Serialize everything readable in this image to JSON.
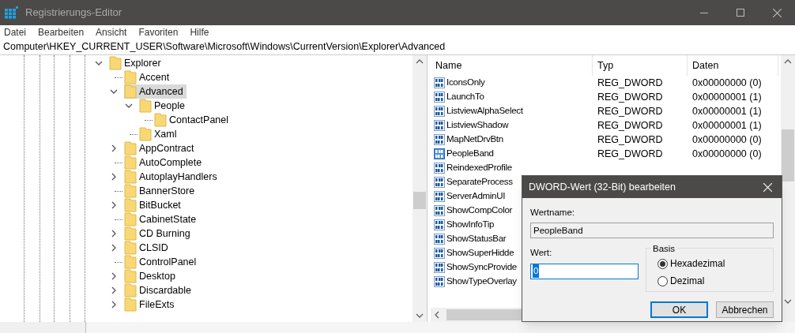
{
  "window": {
    "title": "Registrierungs-Editor"
  },
  "menu": [
    {
      "label": "Datei"
    },
    {
      "label": "Bearbeiten"
    },
    {
      "label": "Ansicht"
    },
    {
      "label": "Favoriten"
    },
    {
      "label": "Hilfe"
    }
  ],
  "address": "Computer\\HKEY_CURRENT_USER\\Software\\Microsoft\\Windows\\CurrentVersion\\Explorer\\Advanced",
  "tree": [
    {
      "label": "Explorer",
      "kind": "expanded",
      "selected": false,
      "children": [
        {
          "label": "Accent",
          "kind": "leaf",
          "selected": false
        },
        {
          "label": "Advanced",
          "kind": "expanded",
          "selected": true,
          "children": [
            {
              "label": "People",
              "kind": "expanded",
              "selected": false,
              "children": [
                {
                  "label": "ContactPanel",
                  "kind": "leaf",
                  "selected": false
                }
              ]
            },
            {
              "label": "Xaml",
              "kind": "leaf",
              "selected": false
            }
          ]
        },
        {
          "label": "AppContract",
          "kind": "collapsed",
          "selected": false
        },
        {
          "label": "AutoComplete",
          "kind": "leaf",
          "selected": false
        },
        {
          "label": "AutoplayHandlers",
          "kind": "collapsed",
          "selected": false
        },
        {
          "label": "BannerStore",
          "kind": "leaf",
          "selected": false
        },
        {
          "label": "BitBucket",
          "kind": "collapsed",
          "selected": false
        },
        {
          "label": "CabinetState",
          "kind": "leaf",
          "selected": false
        },
        {
          "label": "CD Burning",
          "kind": "collapsed",
          "selected": false
        },
        {
          "label": "CLSID",
          "kind": "collapsed",
          "selected": false
        },
        {
          "label": "ControlPanel",
          "kind": "leaf",
          "selected": false
        },
        {
          "label": "Desktop",
          "kind": "collapsed",
          "selected": false
        },
        {
          "label": "Discardable",
          "kind": "collapsed",
          "selected": false
        },
        {
          "label": "FileExts",
          "kind": "collapsed",
          "selected": false
        }
      ]
    }
  ],
  "values": {
    "columns": [
      "Name",
      "Typ",
      "Daten"
    ],
    "rows": [
      {
        "name": "IconsOnly",
        "type": "REG_DWORD",
        "data": "0x00000000 (0)",
        "selected": false
      },
      {
        "name": "LaunchTo",
        "type": "REG_DWORD",
        "data": "0x00000001 (1)",
        "selected": false
      },
      {
        "name": "ListviewAlphaSelect",
        "type": "REG_DWORD",
        "data": "0x00000001 (1)",
        "selected": false
      },
      {
        "name": "ListviewShadow",
        "type": "REG_DWORD",
        "data": "0x00000001 (1)",
        "selected": false
      },
      {
        "name": "MapNetDrvBtn",
        "type": "REG_DWORD",
        "data": "0x00000000 (0)",
        "selected": false
      },
      {
        "name": "PeopleBand",
        "type": "REG_DWORD",
        "data": "0x00000000 (0)",
        "selected": true
      },
      {
        "name": "ReindexedProfile",
        "selected": false
      },
      {
        "name": "SeparateProcess",
        "selected": false
      },
      {
        "name": "ServerAdminUI",
        "selected": false
      },
      {
        "name": "ShowCompColor",
        "selected": false
      },
      {
        "name": "ShowInfoTip",
        "selected": false
      },
      {
        "name": "ShowStatusBar",
        "selected": false
      },
      {
        "name": "ShowSuperHidde",
        "selected": false
      },
      {
        "name": "ShowSyncProvide",
        "selected": false
      },
      {
        "name": "ShowTypeOverlay",
        "selected": false
      }
    ]
  },
  "dialog": {
    "title": "DWORD-Wert (32-Bit) bearbeiten",
    "name_label": "Wertname:",
    "name_value": "PeopleBand",
    "value_label": "Wert:",
    "value": "0",
    "base_label": "Basis",
    "bases": [
      {
        "label": "Hexadezimal",
        "selected": true
      },
      {
        "label": "Dezimal",
        "selected": false
      }
    ],
    "buttons": [
      {
        "label": "OK",
        "focused": true
      },
      {
        "label": "Abbrechen",
        "focused": false
      }
    ]
  }
}
